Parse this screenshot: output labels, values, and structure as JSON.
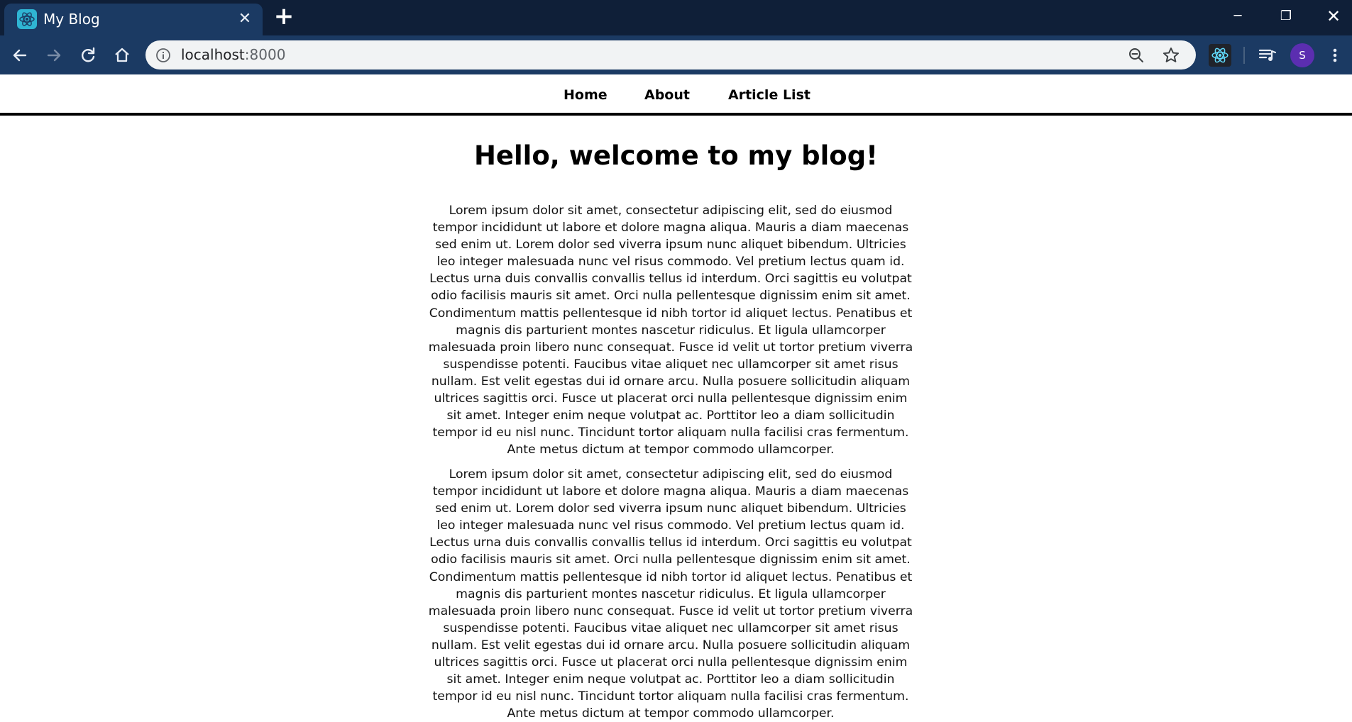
{
  "browser": {
    "tab_title": "My Blog",
    "address": {
      "host": "localhost",
      "port": ":8000"
    },
    "profile_initial": "S",
    "icons": {
      "tab_favicon": "react-icon",
      "close_tab": "close-icon",
      "new_tab": "plus-icon",
      "back": "back-arrow-icon",
      "forward": "forward-arrow-icon",
      "reload": "reload-icon",
      "home": "home-icon",
      "site_info": "info-icon",
      "zoom": "zoom-out-icon",
      "bookmark": "star-icon",
      "extension": "react-devtools-icon",
      "media": "media-control-icon",
      "menu": "kebab-menu-icon"
    }
  },
  "site": {
    "nav": [
      "Home",
      "About",
      "Article List"
    ],
    "heading": "Hello, welcome to my blog!",
    "paragraphs": [
      "Lorem ipsum dolor sit amet, consectetur adipiscing elit, sed do eiusmod tempor incididunt ut labore et dolore magna aliqua. Mauris a diam maecenas sed enim ut. Lorem dolor sed viverra ipsum nunc aliquet bibendum. Ultricies leo integer malesuada nunc vel risus commodo. Vel pretium lectus quam id. Lectus urna duis convallis convallis tellus id interdum. Orci sagittis eu volutpat odio facilisis mauris sit amet. Orci nulla pellentesque dignissim enim sit amet. Condimentum mattis pellentesque id nibh tortor id aliquet lectus. Penatibus et magnis dis parturient montes nascetur ridiculus. Et ligula ullamcorper malesuada proin libero nunc consequat. Fusce id velit ut tortor pretium viverra suspendisse potenti. Faucibus vitae aliquet nec ullamcorper sit amet risus nullam. Est velit egestas dui id ornare arcu. Nulla posuere sollicitudin aliquam ultrices sagittis orci. Fusce ut placerat orci nulla pellentesque dignissim enim sit amet. Integer enim neque volutpat ac. Porttitor leo a diam sollicitudin tempor id eu nisl nunc. Tincidunt tortor aliquam nulla facilisi cras fermentum. Ante metus dictum at tempor commodo ullamcorper.",
      "Lorem ipsum dolor sit amet, consectetur adipiscing elit, sed do eiusmod tempor incididunt ut labore et dolore magna aliqua. Mauris a diam maecenas sed enim ut. Lorem dolor sed viverra ipsum nunc aliquet bibendum. Ultricies leo integer malesuada nunc vel risus commodo. Vel pretium lectus quam id. Lectus urna duis convallis convallis tellus id interdum. Orci sagittis eu volutpat odio facilisis mauris sit amet. Orci nulla pellentesque dignissim enim sit amet. Condimentum mattis pellentesque id nibh tortor id aliquet lectus. Penatibus et magnis dis parturient montes nascetur ridiculus. Et ligula ullamcorper malesuada proin libero nunc consequat. Fusce id velit ut tortor pretium viverra suspendisse potenti. Faucibus vitae aliquet nec ullamcorper sit amet risus nullam. Est velit egestas dui id ornare arcu. Nulla posuere sollicitudin aliquam ultrices sagittis orci. Fusce ut placerat orci nulla pellentesque dignissim enim sit amet. Integer enim neque volutpat ac. Porttitor leo a diam sollicitudin tempor id eu nisl nunc. Tincidunt tortor aliquam nulla facilisi cras fermentum. Ante metus dictum at tempor commodo ullamcorper."
    ]
  }
}
